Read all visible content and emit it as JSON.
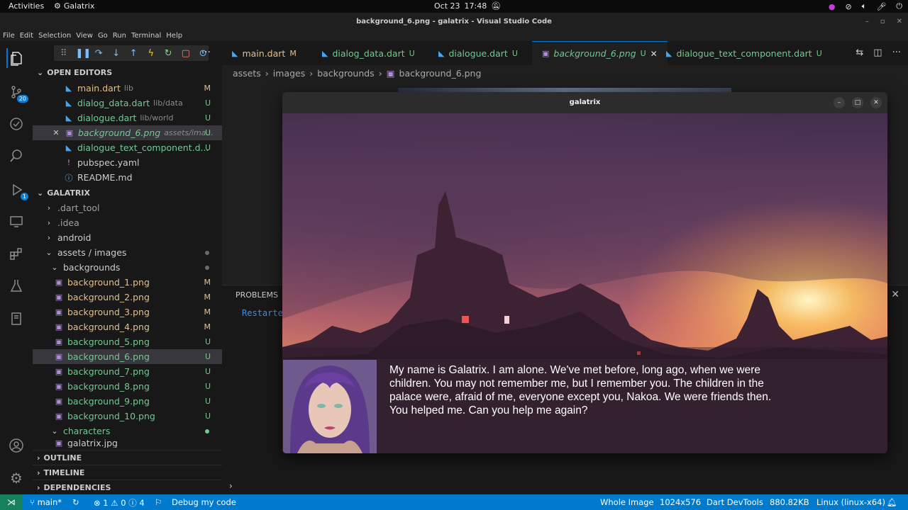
{
  "topbar": {
    "activities": "Activities",
    "app_name": "Galatrix",
    "date": "Oct 23",
    "time": "17:48"
  },
  "window": {
    "title": "background_6.png - galatrix - Visual Studio Code"
  },
  "menu": [
    "File",
    "Edit",
    "Selection",
    "View",
    "Go",
    "Run",
    "Terminal",
    "Help"
  ],
  "activity": {
    "scm_badge": "20",
    "debug_badge": "1"
  },
  "open_editors": {
    "header": "OPEN EDITORS",
    "items": [
      {
        "name": "main.dart",
        "path": "lib",
        "status": "M"
      },
      {
        "name": "dialog_data.dart",
        "path": "lib/data",
        "status": "U"
      },
      {
        "name": "dialogue.dart",
        "path": "lib/world",
        "status": "U"
      },
      {
        "name": "background_6.png",
        "path": "assets/ima...",
        "status": "U"
      },
      {
        "name": "dialogue_text_component.d...",
        "path": "",
        "status": "U"
      },
      {
        "name": "pubspec.yaml",
        "path": "",
        "status": ""
      },
      {
        "name": "README.md",
        "path": "",
        "status": ""
      }
    ]
  },
  "explorer": {
    "header": "GALATRIX",
    "folders": [
      ".dart_tool",
      ".idea",
      "android"
    ],
    "assets_path": "assets / images",
    "backgrounds_folder": "backgrounds",
    "backgrounds": [
      {
        "name": "background_1.png",
        "status": "M"
      },
      {
        "name": "background_2.png",
        "status": "M"
      },
      {
        "name": "background_3.png",
        "status": "M"
      },
      {
        "name": "background_4.png",
        "status": "M"
      },
      {
        "name": "background_5.png",
        "status": "U"
      },
      {
        "name": "background_6.png",
        "status": "U"
      },
      {
        "name": "background_7.png",
        "status": "U"
      },
      {
        "name": "background_8.png",
        "status": "U"
      },
      {
        "name": "background_9.png",
        "status": "U"
      },
      {
        "name": "background_10.png",
        "status": "U"
      }
    ],
    "characters_folder": "characters",
    "characters_file": "galatrix.jpg"
  },
  "sections": {
    "outline": "OUTLINE",
    "timeline": "TIMELINE",
    "dependencies": "DEPENDENCIES"
  },
  "tabs": [
    {
      "name": "main.dart",
      "status": "M"
    },
    {
      "name": "dialog_data.dart",
      "status": "U"
    },
    {
      "name": "dialogue.dart",
      "status": "U"
    },
    {
      "name": "background_6.png",
      "status": "U"
    },
    {
      "name": "dialogue_text_component.dart",
      "status": "U"
    }
  ],
  "breadcrumb": [
    "assets",
    "images",
    "backgrounds",
    "background_6.png"
  ],
  "panel": {
    "tab": "PROBLEMS",
    "terminal_line": "Restarted"
  },
  "game": {
    "title": "galatrix",
    "dialogue": "My name is Galatrix. I am alone. We've met before, long ago, when we were children. You may not remember me, but I remember you.  The children in the palace were, afraid of me, everyone except you, Nakoa. We were friends then. You helped me.  Can you help me again?"
  },
  "status": {
    "branch": "main*",
    "errors": "1",
    "warnings": "0",
    "infos": "4",
    "debug": "Debug my code",
    "whole_image": "Whole Image",
    "dimensions": "1024x576",
    "devtools": "Dart DevTools",
    "filesize": "880.82KB",
    "platform": "Linux (linux-x64)"
  },
  "colors": {
    "accent": "#007acc",
    "modified": "#e2c08d",
    "untracked": "#73c991"
  }
}
